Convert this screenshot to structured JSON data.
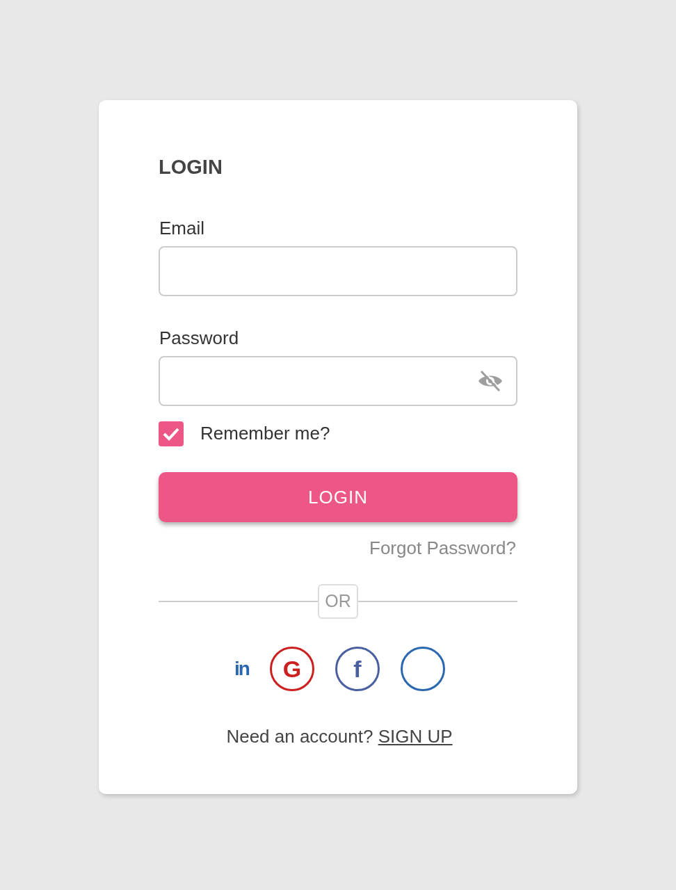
{
  "title": "LOGIN",
  "fields": [
    {
      "label": "Email",
      "kind": "plain"
    },
    {
      "label": "Password",
      "kind": "secret",
      "reveal": false
    }
  ],
  "remember": {
    "label": "Remember me?",
    "checked": true
  },
  "login_button": "LOGIN",
  "forgot": "Forgot Password?",
  "divider": "OR",
  "social": [
    {
      "glyph": "in",
      "color": "#2a67b1",
      "ring": false
    },
    {
      "glyph": "G",
      "color": "#cc1f1f",
      "ring": true
    },
    {
      "glyph": "f",
      "color": "#4a5fa0",
      "ring": true
    },
    {
      "color": "#2a67b1",
      "ring": true
    }
  ],
  "signup": {
    "prompt": "Need an account?",
    "link": "SIGN UP"
  }
}
